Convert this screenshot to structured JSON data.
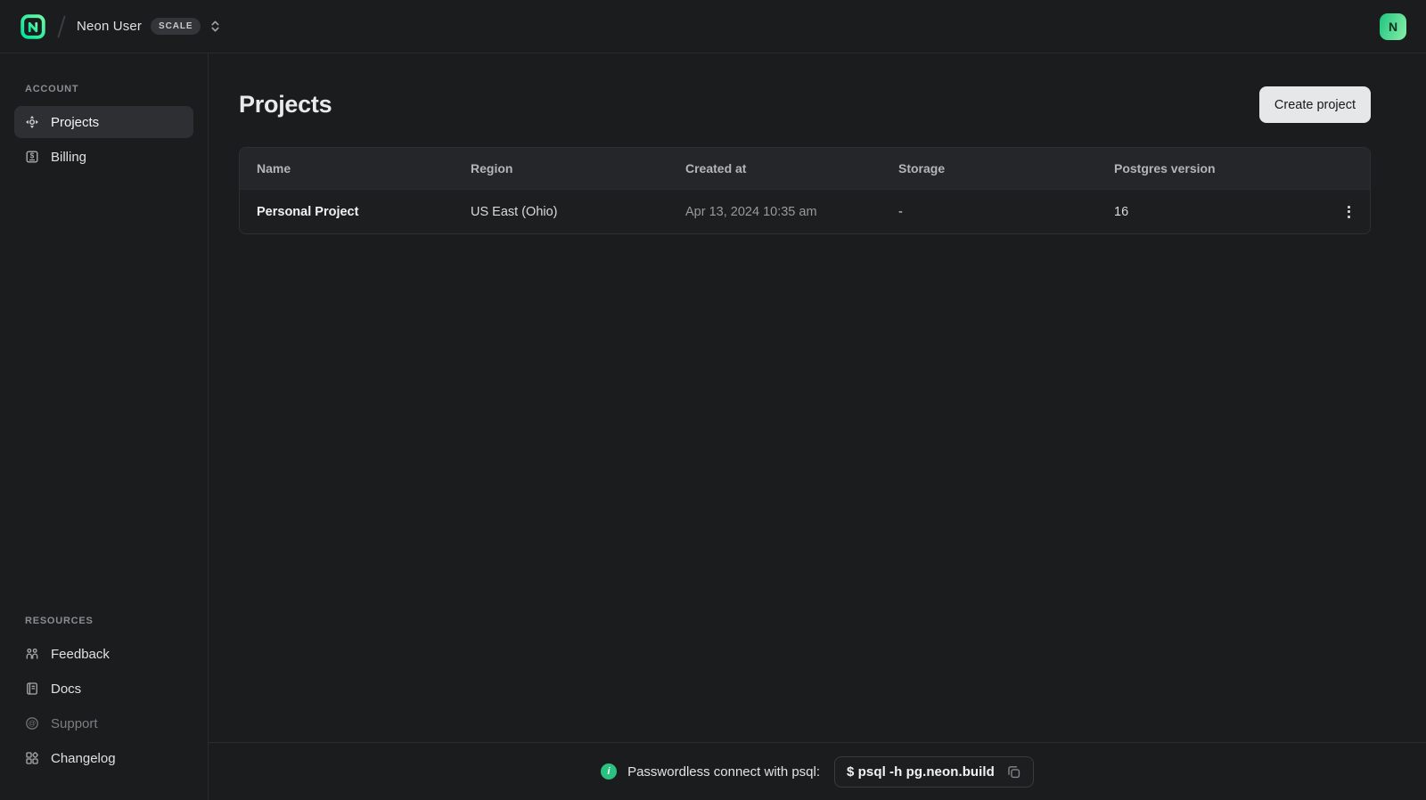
{
  "topbar": {
    "org_name": "Neon User",
    "plan_badge": "SCALE",
    "avatar_initial": "N",
    "logo_icon": "neon-logo-icon",
    "org_switcher_icon": "chevron-up-down-icon"
  },
  "sidebar": {
    "account_label": "ACCOUNT",
    "account_items": [
      {
        "label": "Projects",
        "icon": "projects-icon",
        "active": true
      },
      {
        "label": "Billing",
        "icon": "billing-icon",
        "active": false
      }
    ],
    "resources_label": "RESOURCES",
    "resource_items": [
      {
        "label": "Feedback",
        "icon": "feedback-icon"
      },
      {
        "label": "Docs",
        "icon": "docs-icon"
      },
      {
        "label": "Support",
        "icon": "support-icon",
        "muted": true
      },
      {
        "label": "Changelog",
        "icon": "changelog-icon"
      }
    ]
  },
  "main": {
    "title": "Projects",
    "create_button_label": "Create project",
    "table": {
      "columns": [
        "Name",
        "Region",
        "Created at",
        "Storage",
        "Postgres version"
      ],
      "rows": [
        {
          "name": "Personal Project",
          "region": "US East (Ohio)",
          "created_at": "Apr 13, 2024 10:35 am",
          "storage": "-",
          "postgres_version": "16"
        }
      ],
      "row_menu_icon": "kebab-menu-icon"
    }
  },
  "footer": {
    "info_icon": "info-icon",
    "info_icon_glyph": "i",
    "info_label": "Passwordless connect with psql:",
    "command": "$ psql -h pg.neon.build",
    "copy_icon": "copy-icon"
  },
  "colors": {
    "brand_green": "#00e599",
    "logo_gradient_end": "#6ef7a8",
    "info_green": "#2bc180",
    "background": "#1b1c1e",
    "table_header_bg": "#252629",
    "active_item_bg": "#2e2f32",
    "primary_button_bg": "#e6e7e9",
    "border": "#2a2b2d"
  }
}
